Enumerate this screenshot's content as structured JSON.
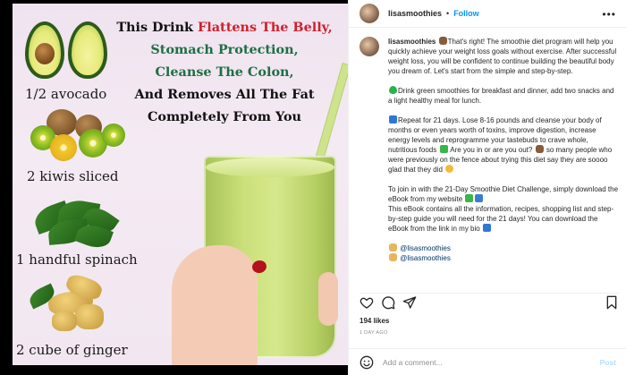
{
  "image": {
    "headline": {
      "line1_prefix": "This Drink ",
      "line1_highlight": "Flattens The Belly,",
      "line2": "Stomach Protection,",
      "line3": "Cleanse The Colon,",
      "line4": "And Removes All The Fat",
      "line5": "Completely From You"
    },
    "ingredients": [
      "1/2 avocado",
      "2 kiwis sliced",
      "1 handful spinach",
      "2 cube of ginger"
    ]
  },
  "header": {
    "username": "lisasmoothies",
    "separator": "•",
    "follow_label": "Follow",
    "more_icon": "more-options-icon"
  },
  "caption": {
    "username": "lisasmoothies",
    "p1": "That's right! The smoothie diet program will help you quickly achieve your weight loss goals without exercise. After successful weight loss, you will be confident to continue building the beautiful body you dream of. Let's start from the simple and step-by-step.",
    "p2": "Drink green smoothies for breakfast and dinner, add two snacks and a light healthy meal for lunch.",
    "p3a": "Repeat for 21 days. Lose 8-16 pounds and cleanse your body of months or even years worth of toxins, improve digestion, increase energy levels and reprogramme your tastebuds to crave whole, nutritious foods",
    "p3b": "Are you in or are you out?",
    "p3c": "so many people who were previously on the fence about trying this diet say they are soooo glad that they did",
    "p4": "To join in with the 21-Day Smoothie Diet Challenge, simply download the eBook from my website",
    "p5": "This eBook contains all the information, recipes, shopping list and step-by-step guide you will need for the 21 days! You can download the eBook from the link in my bio",
    "mention1": "@lisasmoothies",
    "mention2": "@lisasmoothies"
  },
  "actions": {
    "like_icon": "heart-icon",
    "comment_icon": "comment-icon",
    "share_icon": "share-icon",
    "save_icon": "bookmark-icon"
  },
  "stats": {
    "likes": "194 likes",
    "time": "1 DAY AGO"
  },
  "comment_box": {
    "emoji_icon": "emoji-icon",
    "placeholder": "Add a comment...",
    "post_label": "Post"
  },
  "colors": {
    "accent": "#0095f6",
    "text": "#262626",
    "muted": "#8e8e8e",
    "headline_red": "#d0202c",
    "headline_green": "#1e6f43"
  }
}
